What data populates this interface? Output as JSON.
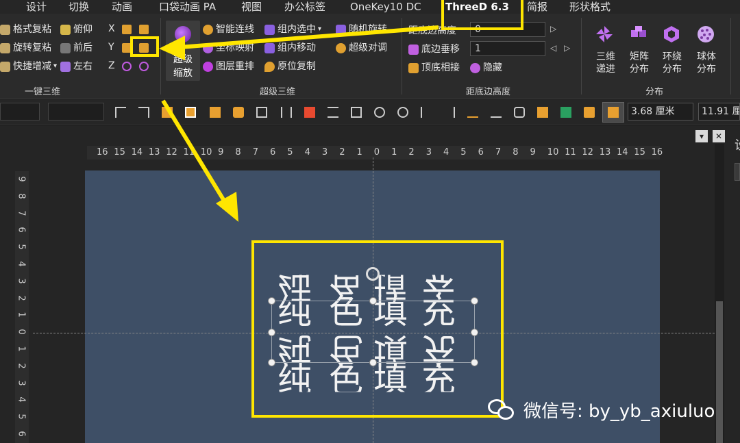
{
  "tabs": [
    "设计",
    "切换",
    "动画",
    "口袋动画 PA",
    "视图",
    "办公标签",
    "OneKey10 DC",
    "ThreeD 6.3",
    "简报",
    "形状格式"
  ],
  "active_tab": "ThreeD 6.3",
  "ribbon": {
    "group1": {
      "items": [
        "格式复粘",
        "旋转复粘",
        "快捷增减",
        "俯仰",
        "前后",
        "左右"
      ],
      "label": "一键三维",
      "axes": [
        "X",
        "Y",
        "Z"
      ]
    },
    "group2": {
      "big_button": [
        "超级",
        "缩放"
      ],
      "items": [
        "智能连线",
        "坐标映射",
        "图层重排",
        "组内选中",
        "组内移动",
        "原位复制",
        "随机旋转",
        "超级对调"
      ],
      "label": "超级三维"
    },
    "group3": {
      "items": [
        "距底边高度",
        "底边垂移",
        "顶底相接",
        "隐藏"
      ],
      "input1": "0",
      "input2": "1",
      "label": "距底边高度"
    },
    "group4": {
      "items": [
        [
          "三维",
          "递进"
        ],
        [
          "矩阵",
          "分布"
        ],
        [
          "环绕",
          "分布"
        ],
        [
          "球体",
          "分布"
        ]
      ],
      "label": "分布"
    }
  },
  "toolbar": {
    "width": "3.68 厘米",
    "height": "11.91 厘"
  },
  "ruler_h": [
    "16",
    "15",
    "14",
    "13",
    "12",
    "11",
    "10",
    "9",
    "8",
    "7",
    "6",
    "5",
    "4",
    "3",
    "2",
    "1",
    "0",
    "1",
    "2",
    "3",
    "4",
    "5",
    "6",
    "7",
    "8",
    "9",
    "10",
    "11",
    "12",
    "13",
    "14",
    "15",
    "16"
  ],
  "ruler_v": [
    "9",
    "8",
    "7",
    "6",
    "5",
    "4",
    "3",
    "2",
    "1",
    "0",
    "1",
    "2",
    "3",
    "4",
    "5",
    "6"
  ],
  "slide_text": {
    "chars": [
      "纯",
      "色",
      "填",
      "充"
    ]
  },
  "watermark": "微信号: by_yb_axiuluo",
  "pane_title": "设",
  "colors": {
    "highlight": "#ffe600",
    "slide_bg": "#3e4f66",
    "ribbon_bg": "#2b2b2b"
  }
}
